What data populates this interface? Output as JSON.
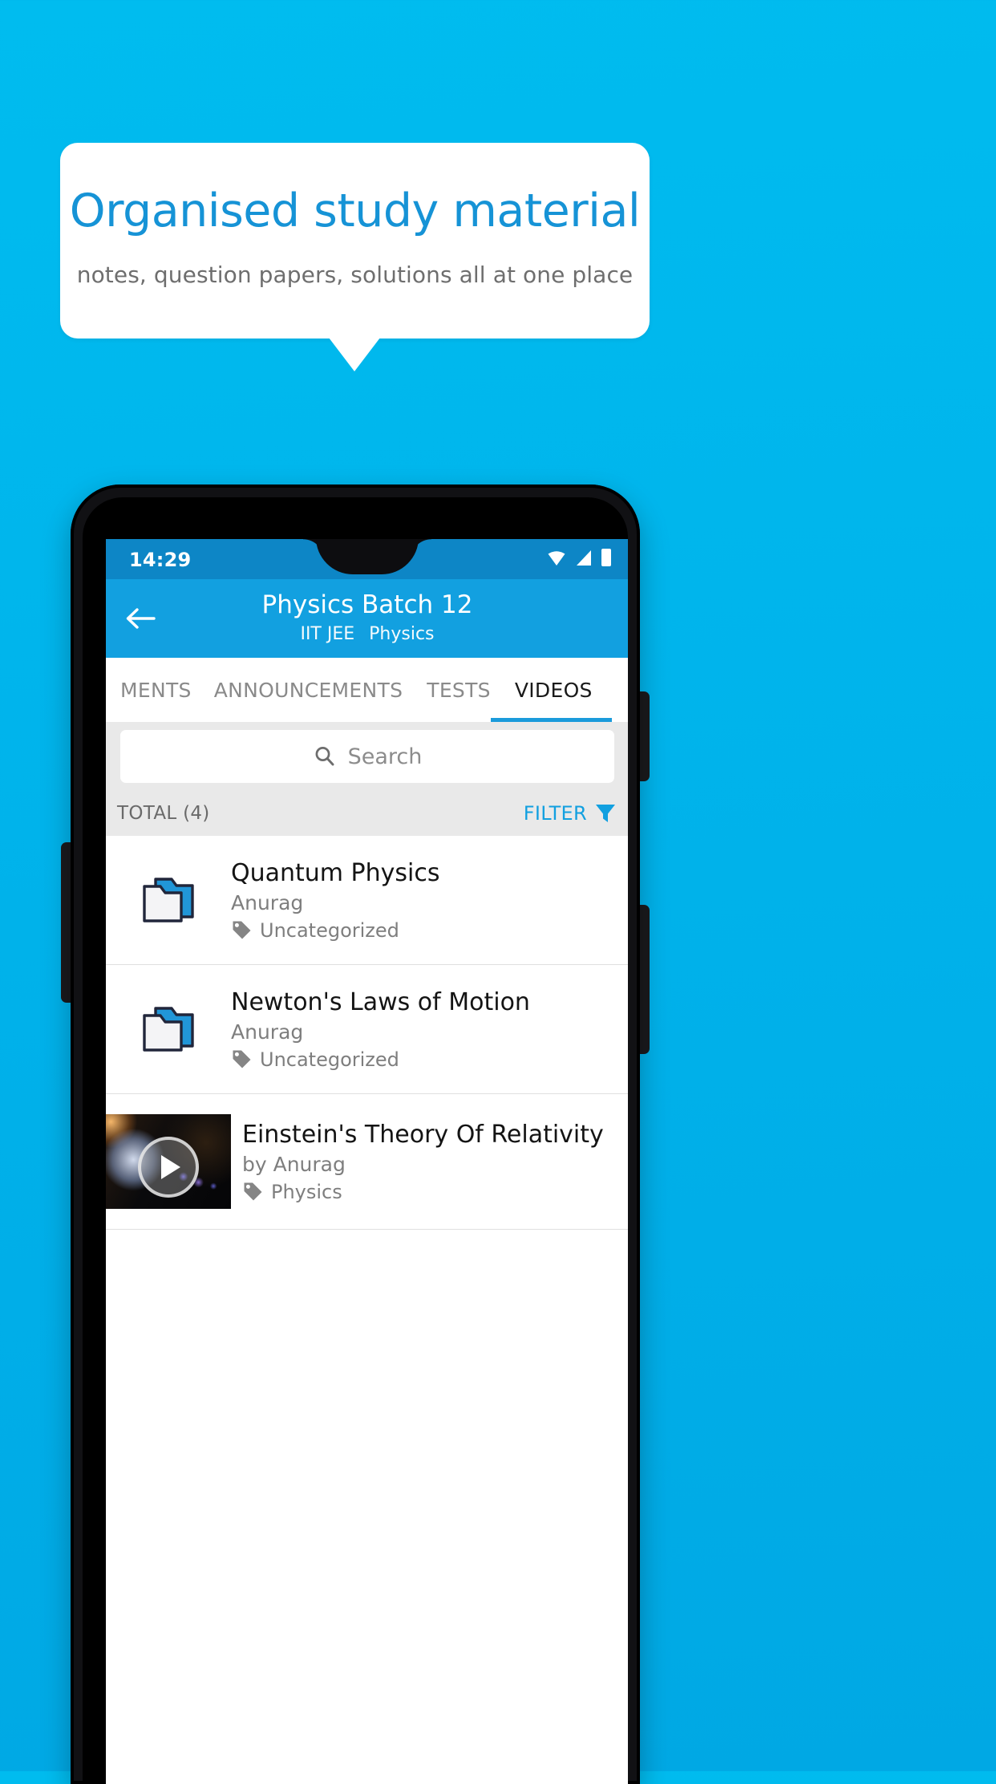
{
  "promo": {
    "title": "Organised study material",
    "subtitle": "notes, question papers, solutions all at one place",
    "title_color": "#1693D6",
    "background_color": "#00B4EC"
  },
  "phone": {
    "statusbar": {
      "time": "14:29",
      "icons": [
        "wifi-icon",
        "signal-icon",
        "battery-icon"
      ]
    },
    "appbar": {
      "back_icon": "back-arrow-icon",
      "title": "Physics Batch 12",
      "subtitle_exam": "IIT JEE",
      "subtitle_subject": "Physics"
    },
    "tabs": [
      {
        "label": "MENTS",
        "active": false
      },
      {
        "label": "ANNOUNCEMENTS",
        "active": false
      },
      {
        "label": "TESTS",
        "active": false
      },
      {
        "label": "VIDEOS",
        "active": true
      }
    ],
    "search": {
      "icon": "search-icon",
      "placeholder": "Search",
      "value": ""
    },
    "listbar": {
      "total_label": "TOTAL (4)",
      "filter_label": "FILTER",
      "filter_icon": "filter-icon",
      "filter_color": "#12A0E0"
    },
    "items": [
      {
        "type": "folder",
        "icon": "folder-icon",
        "title": "Quantum Physics",
        "author": "Anurag",
        "tag_icon": "tag-icon",
        "tag": "Uncategorized"
      },
      {
        "type": "folder",
        "icon": "folder-icon",
        "title": "Newton's Laws of Motion",
        "author": "Anurag",
        "tag_icon": "tag-icon",
        "tag": "Uncategorized"
      },
      {
        "type": "video",
        "icon": "video-thumbnail",
        "play_icon": "play-icon",
        "title": "Einstein's Theory Of Relativity",
        "author": "by Anurag",
        "tag_icon": "tag-icon",
        "tag": "Physics"
      }
    ]
  }
}
